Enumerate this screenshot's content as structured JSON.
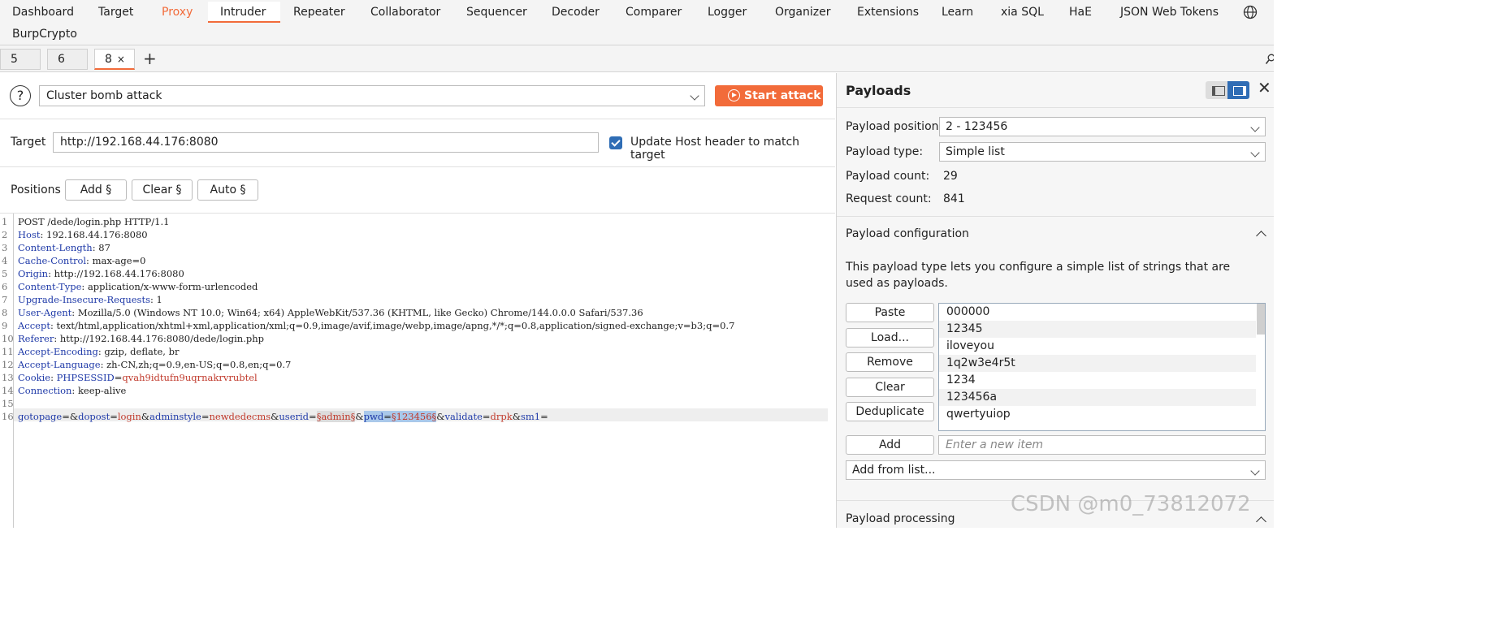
{
  "nav": {
    "items": [
      "Dashboard",
      "Target",
      "Proxy",
      "Intruder",
      "Repeater",
      "Collaborator",
      "Sequencer",
      "Decoder",
      "Comparer",
      "Logger",
      "Organizer",
      "Extensions",
      "Learn",
      "xia SQL",
      "HaE",
      "JSON Web Tokens"
    ],
    "row2": [
      "BurpCrypto"
    ],
    "active": "Intruder",
    "settings_icon": "globe-icon"
  },
  "tabs": {
    "items": [
      "5",
      "6",
      "8"
    ],
    "active": "8",
    "close_glyph": "×",
    "add_glyph": "+"
  },
  "attack": {
    "help_glyph": "?",
    "type": "Cluster bomb attack",
    "start_label": "Start attack"
  },
  "target": {
    "label": "Target",
    "url": "http://192.168.44.176:8080",
    "update_host_label": "Update Host header to match target",
    "update_host_checked": true
  },
  "positions": {
    "label": "Positions",
    "add_label": "Add §",
    "clear_label": "Clear §",
    "auto_label": "Auto §"
  },
  "request": {
    "line_numbers": [
      "1",
      "2",
      "3",
      "4",
      "5",
      "6",
      "7",
      "8",
      "9",
      "10",
      "11",
      "12",
      "13",
      "14",
      "15",
      "16"
    ],
    "request_line": "POST /dede/login.php HTTP/1.1",
    "headers": [
      {
        "name": "Host",
        "value": "192.168.44.176:8080"
      },
      {
        "name": "Content-Length",
        "value": "87"
      },
      {
        "name": "Cache-Control",
        "value": "max-age=0"
      },
      {
        "name": "Origin",
        "value": "http://192.168.44.176:8080"
      },
      {
        "name": "Content-Type",
        "value": "application/x-www-form-urlencoded"
      },
      {
        "name": "Upgrade-Insecure-Requests",
        "value": "1"
      },
      {
        "name": "User-Agent",
        "value": "Mozilla/5.0 (Windows NT 10.0; Win64; x64) AppleWebKit/537.36 (KHTML, like Gecko) Chrome/144.0.0.0 Safari/537.36"
      },
      {
        "name": "Accept",
        "value": "text/html,application/xhtml+xml,application/xml;q=0.9,image/avif,image/webp,image/apng,*/*;q=0.8,application/signed-exchange;v=b3;q=0.7"
      },
      {
        "name": "Referer",
        "value": "http://192.168.44.176:8080/dede/login.php"
      },
      {
        "name": "Accept-Encoding",
        "value": "gzip, deflate, br"
      },
      {
        "name": "Accept-Language",
        "value": "zh-CN,zh;q=0.9,en-US;q=0.8,en;q=0.7"
      },
      {
        "name": "Cookie",
        "value": "",
        "cookie_name": "PHPSESSID",
        "cookie_value": "qvah9idtufn9uqrnakrvrubtel"
      },
      {
        "name": "Connection",
        "value": "keep-alive"
      }
    ],
    "body": {
      "p1_name": "gotopage",
      "p2_name": "dopost",
      "p2_value": "login",
      "p3_name": "adminstyle",
      "p3_value": "newdedecms",
      "p4_name": "userid",
      "p4_value": "§admin§",
      "p5_name": "pwd",
      "p5_value": "§123456§",
      "p6_name": "validate",
      "p6_value": "drpk",
      "p7_name": "sm1"
    }
  },
  "payloads": {
    "title": "Payloads",
    "position_label": "Payload position:",
    "position_value": "2 - 123456",
    "type_label": "Payload type:",
    "type_value": "Simple list",
    "count_label": "Payload count:",
    "count_value": "29",
    "request_count_label": "Request count:",
    "request_count_value": "841",
    "config_title": "Payload configuration",
    "config_desc": "This payload type lets you configure a simple list of strings that are used as payloads.",
    "buttons": {
      "paste": "Paste",
      "load": "Load...",
      "remove": "Remove",
      "clear": "Clear",
      "dedupe": "Deduplicate",
      "add": "Add"
    },
    "list": [
      "000000",
      "12345",
      "iloveyou",
      "1q2w3e4r5t",
      "1234",
      "123456a",
      "qwertyuiop"
    ],
    "add_placeholder": "Enter a new item",
    "add_from_list": "Add from list...",
    "processing_title": "Payload processing"
  },
  "watermark": "CSDN @m0_73812072",
  "colors": {
    "accent": "#f26b3a",
    "checkbox": "#2f6db5",
    "header_name": "#1f3aa8",
    "param_value": "#c0392b"
  }
}
